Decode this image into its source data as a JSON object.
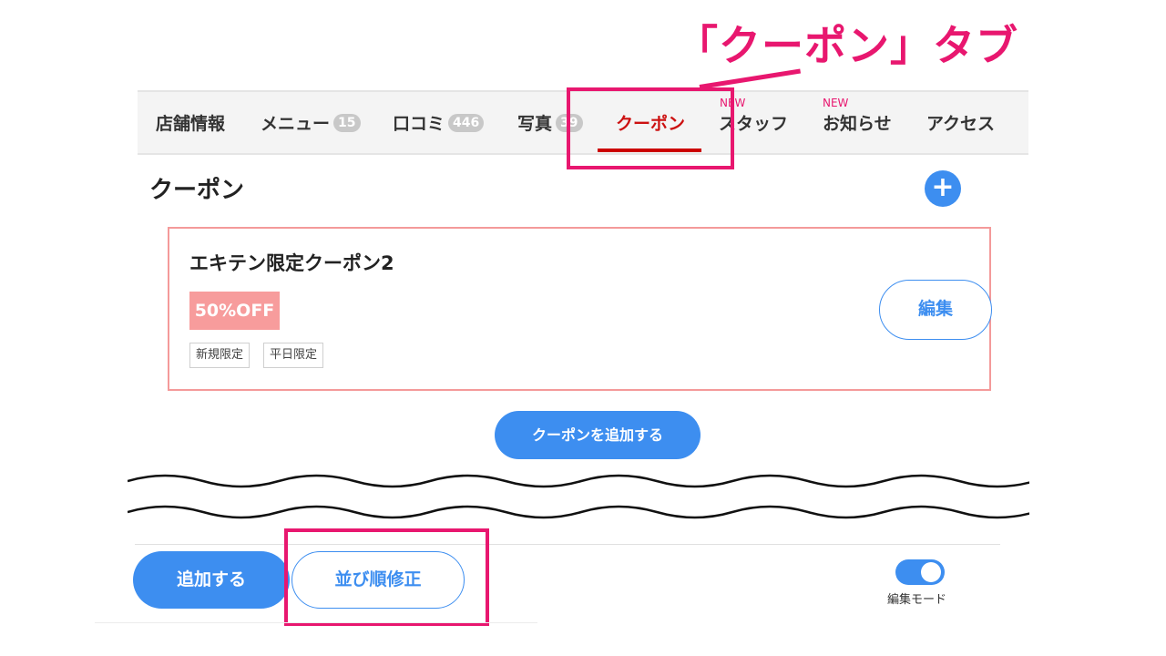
{
  "annotations": {
    "tab_callout": "「クーポン」タブ"
  },
  "tabs": [
    {
      "label": "店舗情報"
    },
    {
      "label": "メニュー",
      "count": "15"
    },
    {
      "label": "口コミ",
      "count": "446"
    },
    {
      "label": "写真",
      "count": "39"
    },
    {
      "label": "クーポン",
      "active": true
    },
    {
      "label": "スタッフ",
      "badge": "NEW"
    },
    {
      "label": "お知らせ",
      "badge": "NEW"
    },
    {
      "label": "アクセス"
    }
  ],
  "section": {
    "title": "クーポン",
    "add_icon": "plus-icon"
  },
  "coupon": {
    "title": "エキテン限定クーポン2",
    "discount": "50%OFF",
    "tags": [
      "新規限定",
      "平日限定"
    ],
    "edit_label": "編集"
  },
  "add_coupon_label": "クーポンを追加する",
  "footer": {
    "add_label": "追加する",
    "sort_label": "並び順修正",
    "mode_label": "編集モード",
    "mode_on": true
  },
  "colors": {
    "accent": "#3d8ef0",
    "highlight": "#e8176f",
    "active_tab": "#cc1111",
    "discount_bg": "#f79c9c",
    "card_border": "#f49a9a"
  }
}
